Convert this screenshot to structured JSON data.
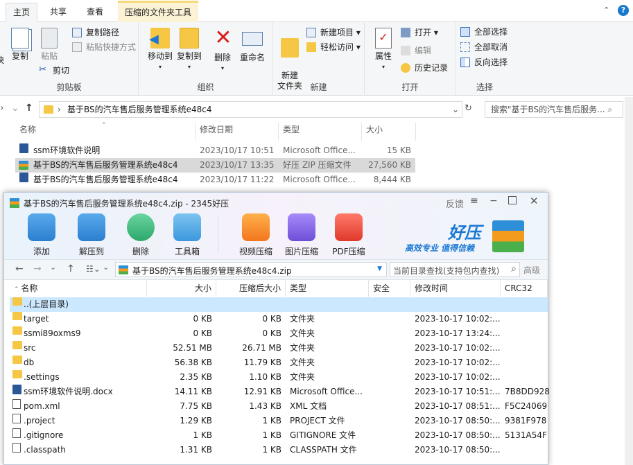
{
  "ribbon": {
    "tabs": [
      "主页",
      "共享",
      "查看",
      "压缩的文件夹工具"
    ],
    "clipboard": {
      "copy": "复制",
      "paste": "粘贴",
      "copy_path": "复制路径",
      "paste_shortcut": "粘贴快捷方式",
      "cut": "剪切",
      "title": "剪贴板",
      "cut_left": "快"
    },
    "organize": {
      "move_to": "移动到",
      "copy_to": "复制到",
      "delete": "删除",
      "rename": "重命名",
      "title": "组织"
    },
    "new": {
      "new_folder": "新建\n文件夹",
      "new_item": "新建项目",
      "easy_access": "轻松访问",
      "title": "新建"
    },
    "open": {
      "properties": "属性",
      "open": "打开",
      "edit": "编辑",
      "history": "历史记录",
      "title": "打开"
    },
    "select": {
      "select_all": "全部选择",
      "select_none": "全部取消",
      "invert": "反向选择",
      "title": "选择"
    }
  },
  "address": {
    "path": "基于BS的汽车售后服务管理系统e48c4",
    "search_placeholder": "搜索\"基于BS的汽车售后服务...  ⌕"
  },
  "explorer_columns": [
    "名称",
    "修改日期",
    "类型",
    "大小"
  ],
  "explorer_files": [
    {
      "name": "ssm环境软件说明",
      "date": "2023/10/17 10:51",
      "type": "Microsoft Office...",
      "size": "15 KB"
    },
    {
      "name": "基于BS的汽车售后服务管理系统e48c4",
      "date": "2023/10/17 13:35",
      "type": "好压 ZIP 压缩文件",
      "size": "27,560 KB"
    },
    {
      "name": "基于BS的汽车售后服务管理系统e48c4",
      "date": "2023/10/17 11:22",
      "type": "Microsoft Office...",
      "size": "8,444 KB"
    }
  ],
  "zip": {
    "title": "基于BS的汽车售后服务管理系统e48c4.zip - 2345好压",
    "feedback": "反馈",
    "tools": [
      "添加",
      "解压到",
      "删除",
      "工具箱",
      "视频压缩",
      "图片压缩",
      "PDF压缩"
    ],
    "brand": "好压",
    "slogan": "高效专业  值得信赖",
    "path": "基于BS的汽车售后服务管理系统e48c4.zip",
    "search_placeholder": "当前目录查找(支持包内查找)",
    "advanced": "高级",
    "columns": [
      "名称",
      "大小",
      "压缩后大小",
      "类型",
      "安全",
      "修改时间",
      "CRC32"
    ],
    "rows": [
      {
        "name": "..(上层目录)",
        "size": "",
        "csize": "",
        "type": "",
        "time": "",
        "crc": "",
        "icon": "folder"
      },
      {
        "name": "target",
        "size": "0 KB",
        "csize": "0 KB",
        "type": "文件夹",
        "time": "2023-10-17 10:02:...",
        "crc": "",
        "icon": "folder"
      },
      {
        "name": "ssmi89oxms9",
        "size": "0 KB",
        "csize": "0 KB",
        "type": "文件夹",
        "time": "2023-10-17 13:24:...",
        "crc": "",
        "icon": "folder"
      },
      {
        "name": "src",
        "size": "52.51 MB",
        "csize": "26.71 MB",
        "type": "文件夹",
        "time": "2023-10-17 10:02:...",
        "crc": "",
        "icon": "folder"
      },
      {
        "name": "db",
        "size": "56.38 KB",
        "csize": "11.79 KB",
        "type": "文件夹",
        "time": "2023-10-17 10:02:...",
        "crc": "",
        "icon": "folder"
      },
      {
        "name": ".settings",
        "size": "2.35 KB",
        "csize": "1.10 KB",
        "type": "文件夹",
        "time": "2023-10-17 10:02:...",
        "crc": "",
        "icon": "folder"
      },
      {
        "name": "ssm环境软件说明.docx",
        "size": "14.11 KB",
        "csize": "12.91 KB",
        "type": "Microsoft Office...",
        "time": "2023-10-17 10:51:...",
        "crc": "7B8DD928",
        "icon": "word"
      },
      {
        "name": "pom.xml",
        "size": "7.75 KB",
        "csize": "1.43 KB",
        "type": "XML 文档",
        "time": "2023-10-17 08:51:...",
        "crc": "F5C24069",
        "icon": "doc"
      },
      {
        "name": ".project",
        "size": "1.29 KB",
        "csize": "1 KB",
        "type": "PROJECT 文件",
        "time": "2023-10-17 08:50:...",
        "crc": "9381F978",
        "icon": "doc"
      },
      {
        "name": ".gitignore",
        "size": "1 KB",
        "csize": "1 KB",
        "type": "GITIGNORE 文件",
        "time": "2023-10-17 08:50:...",
        "crc": "5131A54F",
        "icon": "doc"
      },
      {
        "name": ".classpath",
        "size": "1.31 KB",
        "csize": "1 KB",
        "type": "CLASSPATH 文件",
        "time": "2023-10-17 08:50:...",
        "crc": "",
        "icon": "doc"
      }
    ]
  },
  "colors": {
    "context_tab": "#fcf3d6",
    "selection": "#cce8ff",
    "zip_brand": "#1a78d4"
  }
}
